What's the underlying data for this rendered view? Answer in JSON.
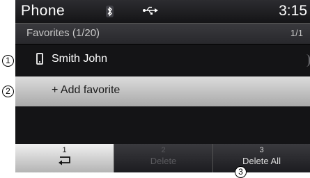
{
  "status": {
    "app_title": "Phone",
    "clock": "3:15",
    "bluetooth_icon": "bluetooth-icon",
    "usb_icon": "usb-icon"
  },
  "list": {
    "title": "Favorites (1/20)",
    "page": "1/1",
    "items": [
      {
        "label": "Smith John",
        "icon": "phone-icon"
      }
    ],
    "add_label": "+ Add favorite"
  },
  "softkeys": [
    {
      "number": "1",
      "label": "",
      "icon": "back-arrow-icon",
      "enabled": true
    },
    {
      "number": "2",
      "label": "Delete",
      "enabled": false
    },
    {
      "number": "3",
      "label": "Delete All",
      "enabled": true
    }
  ],
  "callouts": [
    "1",
    "2",
    "3"
  ]
}
